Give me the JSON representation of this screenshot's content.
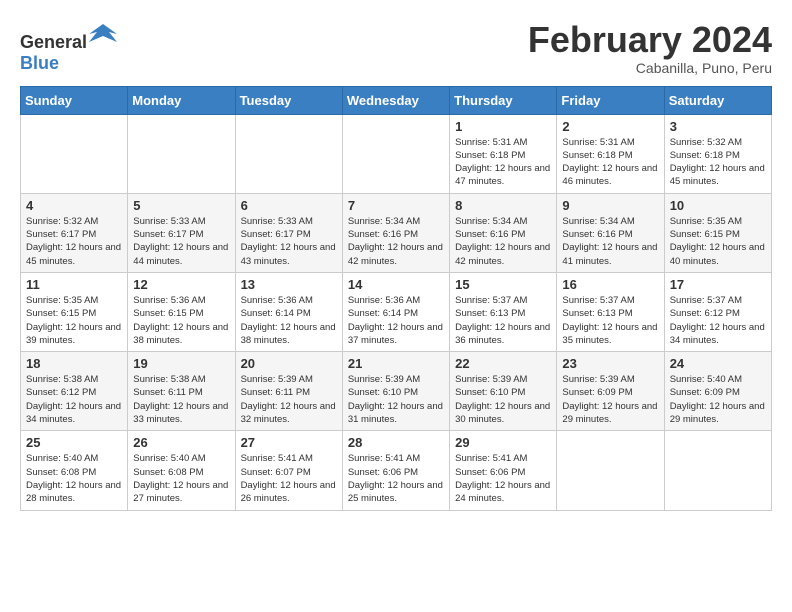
{
  "logo": {
    "text_general": "General",
    "text_blue": "Blue"
  },
  "header": {
    "month_title": "February 2024",
    "subtitle": "Cabanilla, Puno, Peru"
  },
  "weekdays": [
    "Sunday",
    "Monday",
    "Tuesday",
    "Wednesday",
    "Thursday",
    "Friday",
    "Saturday"
  ],
  "weeks": [
    [
      {
        "day": "",
        "info": ""
      },
      {
        "day": "",
        "info": ""
      },
      {
        "day": "",
        "info": ""
      },
      {
        "day": "",
        "info": ""
      },
      {
        "day": "1",
        "info": "Sunrise: 5:31 AM\nSunset: 6:18 PM\nDaylight: 12 hours\nand 47 minutes."
      },
      {
        "day": "2",
        "info": "Sunrise: 5:31 AM\nSunset: 6:18 PM\nDaylight: 12 hours\nand 46 minutes."
      },
      {
        "day": "3",
        "info": "Sunrise: 5:32 AM\nSunset: 6:18 PM\nDaylight: 12 hours\nand 45 minutes."
      }
    ],
    [
      {
        "day": "4",
        "info": "Sunrise: 5:32 AM\nSunset: 6:17 PM\nDaylight: 12 hours\nand 45 minutes."
      },
      {
        "day": "5",
        "info": "Sunrise: 5:33 AM\nSunset: 6:17 PM\nDaylight: 12 hours\nand 44 minutes."
      },
      {
        "day": "6",
        "info": "Sunrise: 5:33 AM\nSunset: 6:17 PM\nDaylight: 12 hours\nand 43 minutes."
      },
      {
        "day": "7",
        "info": "Sunrise: 5:34 AM\nSunset: 6:16 PM\nDaylight: 12 hours\nand 42 minutes."
      },
      {
        "day": "8",
        "info": "Sunrise: 5:34 AM\nSunset: 6:16 PM\nDaylight: 12 hours\nand 42 minutes."
      },
      {
        "day": "9",
        "info": "Sunrise: 5:34 AM\nSunset: 6:16 PM\nDaylight: 12 hours\nand 41 minutes."
      },
      {
        "day": "10",
        "info": "Sunrise: 5:35 AM\nSunset: 6:15 PM\nDaylight: 12 hours\nand 40 minutes."
      }
    ],
    [
      {
        "day": "11",
        "info": "Sunrise: 5:35 AM\nSunset: 6:15 PM\nDaylight: 12 hours\nand 39 minutes."
      },
      {
        "day": "12",
        "info": "Sunrise: 5:36 AM\nSunset: 6:15 PM\nDaylight: 12 hours\nand 38 minutes."
      },
      {
        "day": "13",
        "info": "Sunrise: 5:36 AM\nSunset: 6:14 PM\nDaylight: 12 hours\nand 38 minutes."
      },
      {
        "day": "14",
        "info": "Sunrise: 5:36 AM\nSunset: 6:14 PM\nDaylight: 12 hours\nand 37 minutes."
      },
      {
        "day": "15",
        "info": "Sunrise: 5:37 AM\nSunset: 6:13 PM\nDaylight: 12 hours\nand 36 minutes."
      },
      {
        "day": "16",
        "info": "Sunrise: 5:37 AM\nSunset: 6:13 PM\nDaylight: 12 hours\nand 35 minutes."
      },
      {
        "day": "17",
        "info": "Sunrise: 5:37 AM\nSunset: 6:12 PM\nDaylight: 12 hours\nand 34 minutes."
      }
    ],
    [
      {
        "day": "18",
        "info": "Sunrise: 5:38 AM\nSunset: 6:12 PM\nDaylight: 12 hours\nand 34 minutes."
      },
      {
        "day": "19",
        "info": "Sunrise: 5:38 AM\nSunset: 6:11 PM\nDaylight: 12 hours\nand 33 minutes."
      },
      {
        "day": "20",
        "info": "Sunrise: 5:39 AM\nSunset: 6:11 PM\nDaylight: 12 hours\nand 32 minutes."
      },
      {
        "day": "21",
        "info": "Sunrise: 5:39 AM\nSunset: 6:10 PM\nDaylight: 12 hours\nand 31 minutes."
      },
      {
        "day": "22",
        "info": "Sunrise: 5:39 AM\nSunset: 6:10 PM\nDaylight: 12 hours\nand 30 minutes."
      },
      {
        "day": "23",
        "info": "Sunrise: 5:39 AM\nSunset: 6:09 PM\nDaylight: 12 hours\nand 29 minutes."
      },
      {
        "day": "24",
        "info": "Sunrise: 5:40 AM\nSunset: 6:09 PM\nDaylight: 12 hours\nand 29 minutes."
      }
    ],
    [
      {
        "day": "25",
        "info": "Sunrise: 5:40 AM\nSunset: 6:08 PM\nDaylight: 12 hours\nand 28 minutes."
      },
      {
        "day": "26",
        "info": "Sunrise: 5:40 AM\nSunset: 6:08 PM\nDaylight: 12 hours\nand 27 minutes."
      },
      {
        "day": "27",
        "info": "Sunrise: 5:41 AM\nSunset: 6:07 PM\nDaylight: 12 hours\nand 26 minutes."
      },
      {
        "day": "28",
        "info": "Sunrise: 5:41 AM\nSunset: 6:06 PM\nDaylight: 12 hours\nand 25 minutes."
      },
      {
        "day": "29",
        "info": "Sunrise: 5:41 AM\nSunset: 6:06 PM\nDaylight: 12 hours\nand 24 minutes."
      },
      {
        "day": "",
        "info": ""
      },
      {
        "day": "",
        "info": ""
      }
    ]
  ]
}
